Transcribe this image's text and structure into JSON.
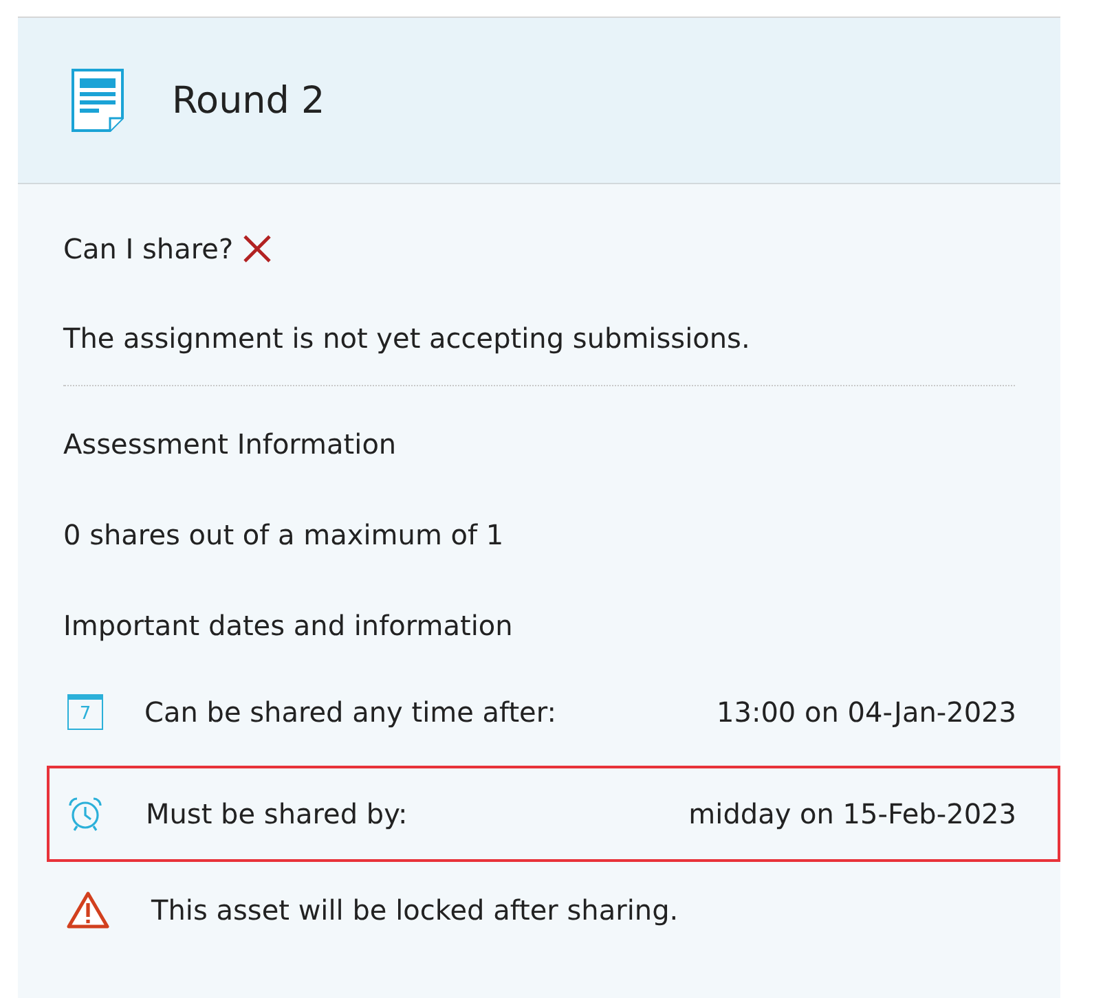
{
  "header": {
    "title": "Round 2"
  },
  "can_share": {
    "label": "Can I share?",
    "allowed": false
  },
  "status_message": "The assignment is not yet accepting submissions.",
  "assessment_heading": "Assessment Information",
  "shares_summary": "0 shares out of a maximum of 1",
  "dates_heading": "Important dates and information",
  "dates": [
    {
      "kind": "calendar",
      "calendar_day": "7",
      "label": "Can be shared any time after:",
      "value": "13:00 on 04-Jan-2023",
      "highlighted": false
    },
    {
      "kind": "alarm",
      "label": "Must be shared by:",
      "value": "midday on 15-Feb-2023",
      "highlighted": true
    }
  ],
  "warning": "This asset will be locked after sharing."
}
